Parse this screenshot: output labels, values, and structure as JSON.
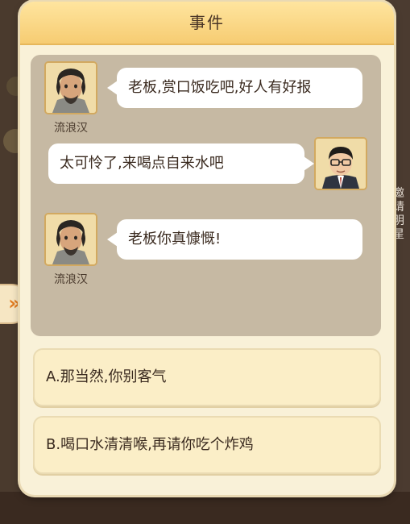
{
  "dialog": {
    "title": "事件"
  },
  "messages": [
    {
      "speaker": "流浪汉",
      "text": "老板,赏口饭吃吧,好人有好报",
      "side": "left",
      "avatar": "vagrant-avatar"
    },
    {
      "speaker": "",
      "text": "太可怜了,来喝点自来水吧",
      "side": "right",
      "avatar": "boss-avatar"
    },
    {
      "speaker": "流浪汉",
      "text": "老板你真慷慨!",
      "side": "left",
      "avatar": "vagrant-avatar"
    }
  ],
  "options": [
    {
      "label": "A.那当然,你别客气"
    },
    {
      "label": "B.喝口水清清喉,再请你吃个炸鸡"
    }
  ],
  "background": {
    "side_label": "邀请明星",
    "side_tab_icon": "»"
  },
  "colors": {
    "header": "#f6cc72",
    "panel": "#f9f1d8",
    "chat_area": "#c6b9a3",
    "option_bg": "#fbeec7",
    "accent_orange": "#e17b1f"
  }
}
